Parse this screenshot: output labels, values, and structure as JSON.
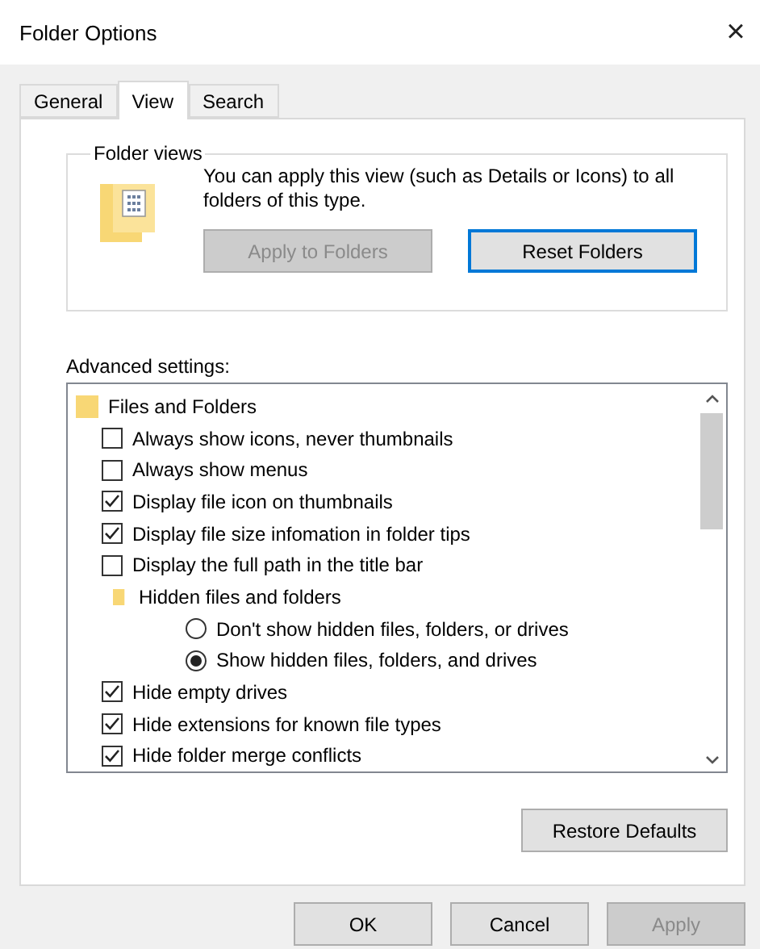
{
  "window": {
    "title": "Folder Options",
    "close": "×"
  },
  "tabs": [
    {
      "label": "General",
      "selected": false
    },
    {
      "label": "View",
      "selected": true
    },
    {
      "label": "Search",
      "selected": false
    }
  ],
  "folder_views": {
    "legend": "Folder views",
    "description": "You can apply this view (such as Details or Icons) to all folders of this type.",
    "buttons": [
      {
        "label": "Apply to Folders",
        "disabled": true,
        "focused": false
      },
      {
        "label": "Reset Folders",
        "disabled": false,
        "focused": true
      }
    ]
  },
  "advanced": {
    "label": "Advanced settings:",
    "items": [
      {
        "kind": "folder",
        "label": "Files and Folders",
        "children": [
          {
            "kind": "checkbox",
            "label": "Always show icons, never thumbnails",
            "checked": false
          },
          {
            "kind": "checkbox",
            "label": "Always show menus",
            "checked": false
          },
          {
            "kind": "checkbox",
            "label": "Display file icon on thumbnails",
            "checked": true
          },
          {
            "kind": "checkbox",
            "label": "Display file size infomation in folder tips",
            "checked": true
          },
          {
            "kind": "checkbox",
            "label": "Display the full path in the title bar",
            "checked": false
          },
          {
            "kind": "folder",
            "label": "Hidden files and folders",
            "children": [
              {
                "kind": "radio",
                "label": "Don't show hidden files, folders, or drives",
                "selected": false
              },
              {
                "kind": "radio",
                "label": "Show hidden files, folders, and drives",
                "selected": true
              }
            ]
          },
          {
            "kind": "checkbox",
            "label": "Hide empty drives",
            "checked": true
          },
          {
            "kind": "checkbox",
            "label": "Hide extensions for known file types",
            "checked": true
          },
          {
            "kind": "checkbox",
            "label": "Hide folder merge conflicts",
            "checked": true
          }
        ]
      }
    ]
  },
  "restore_button": "Restore Defaults",
  "buttons": [
    {
      "label": "OK",
      "disabled": false
    },
    {
      "label": "Cancel",
      "disabled": false
    },
    {
      "label": "Apply",
      "disabled": true
    }
  ]
}
